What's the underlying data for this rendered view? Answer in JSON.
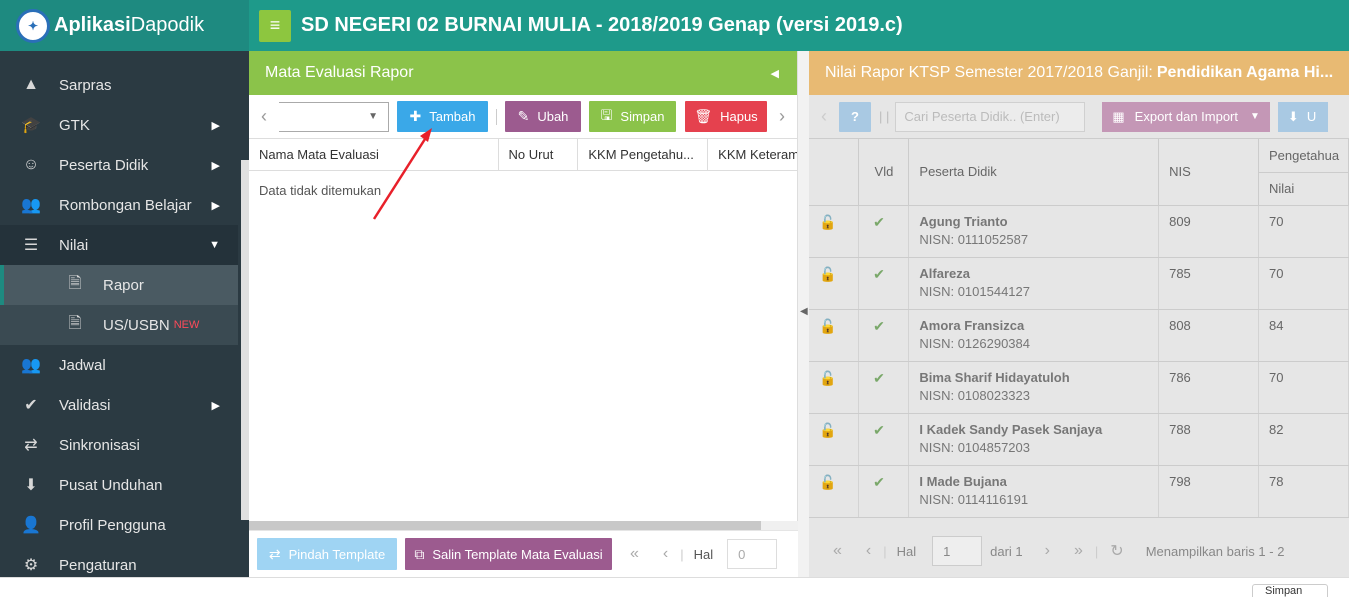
{
  "app": {
    "brand_bold": "Aplikasi",
    "brand_light": "Dapodik",
    "title": "SD NEGERI 02 BURNAI MULIA - 2018/2019 Genap (versi 2019.c)"
  },
  "sidebar": {
    "items": [
      {
        "label": "Sarpras",
        "icon": "building-icon"
      },
      {
        "label": "GTK",
        "icon": "graduation-cap-icon"
      },
      {
        "label": "Peserta Didik",
        "icon": "smiley-icon"
      },
      {
        "label": "Rombongan Belajar",
        "icon": "users-icon"
      },
      {
        "label": "Nilai",
        "icon": "list-icon"
      },
      {
        "label": "Rapor",
        "icon": "document-icon"
      },
      {
        "label": "US/USBN",
        "icon": "document-icon",
        "badge": "NEW"
      },
      {
        "label": "Jadwal",
        "icon": "users-icon"
      },
      {
        "label": "Validasi",
        "icon": "check-icon"
      },
      {
        "label": "Sinkronisasi",
        "icon": "exchange-icon"
      },
      {
        "label": "Pusat Unduhan",
        "icon": "download-icon"
      },
      {
        "label": "Profil Pengguna",
        "icon": "user-icon"
      },
      {
        "label": "Pengaturan",
        "icon": "gear-icon"
      }
    ]
  },
  "left_panel": {
    "title": "Mata Evaluasi Rapor",
    "buttons": {
      "tambah": "Tambah",
      "ubah": "Ubah",
      "simpan": "Simpan",
      "hapus": "Hapus"
    },
    "columns": [
      "Nama Mata Evaluasi",
      "No Urut",
      "KKM Pengetahu...",
      "KKM Keteram"
    ],
    "empty_message": "Data tidak ditemukan",
    "bottom": {
      "pindah_template": "Pindah Template",
      "salin_template": "Salin Template Mata Evaluasi",
      "hal_label": "Hal",
      "page_value": "0"
    }
  },
  "right_panel": {
    "title_prefix": "Nilai Rapor KTSP Semester 2017/2018 Ganjil:",
    "title_bold": "Pendidikan Agama Hi...",
    "search_placeholder": "Cari Peserta Didik.. (Enter)",
    "export_label": "Export dan Import",
    "upload_label": "U",
    "help_label": "?",
    "columns": {
      "vld": "Vld",
      "peserta": "Peserta Didik",
      "nis": "NIS",
      "pengetahuan": "Pengetahua",
      "nilai": "Nilai"
    },
    "students": [
      {
        "name": "Agung Trianto",
        "nisn": "NISN: 0111052587",
        "nis": "809",
        "nilai": "70"
      },
      {
        "name": "Alfareza",
        "nisn": "NISN: 0101544127",
        "nis": "785",
        "nilai": "70"
      },
      {
        "name": "Amora Fransizca",
        "nisn": "NISN: 0126290384",
        "nis": "808",
        "nilai": "84"
      },
      {
        "name": "Bima Sharif Hidayatuloh",
        "nisn": "NISN: 0108023323",
        "nis": "786",
        "nilai": "70"
      },
      {
        "name": "I Kadek Sandy Pasek Sanjaya",
        "nisn": "NISN: 0104857203",
        "nis": "788",
        "nilai": "82"
      },
      {
        "name": "I Made Bujana",
        "nisn": "NISN: 0114116191",
        "nis": "798",
        "nilai": "78"
      }
    ],
    "bottom": {
      "hal_label": "Hal",
      "page_value": "1",
      "of_label": "dari 1",
      "showing": "Menampilkan baris 1 - 2"
    }
  },
  "statusbar": {
    "button_label": "Simpan"
  }
}
